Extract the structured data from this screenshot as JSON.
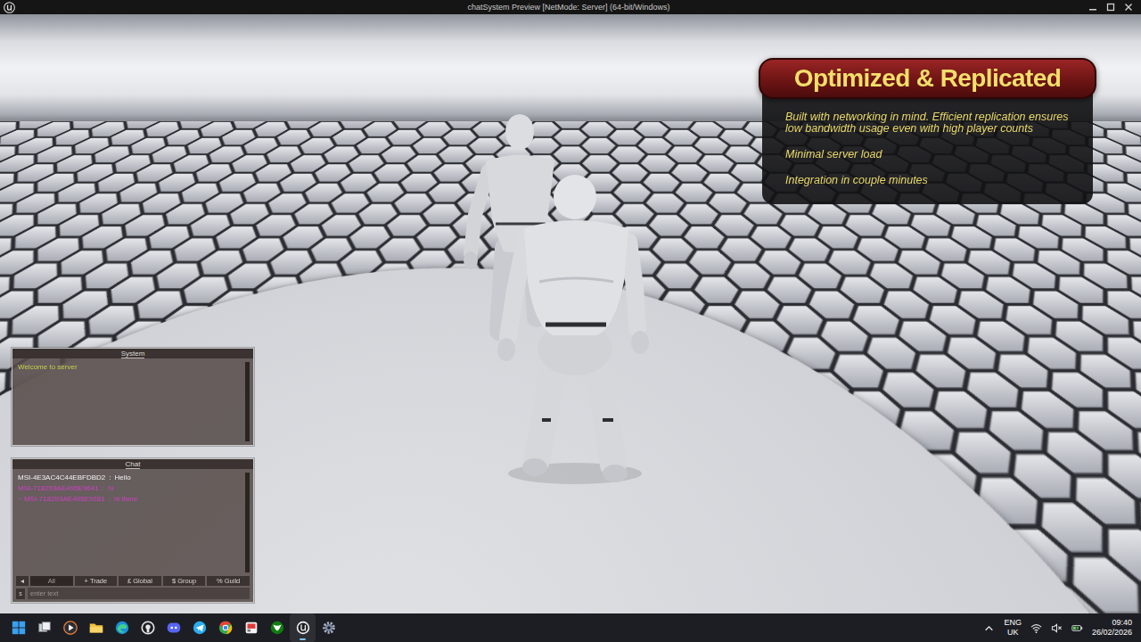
{
  "window": {
    "title": "chatSystem Preview [NetMode: Server]  (64-bit/Windows)"
  },
  "info_panel": {
    "title": "Optimized & Replicated",
    "lines": [
      "Built with networking in mind. Efficient replication ensures low bandwidth usage even with high player counts",
      "Minimal server load",
      "Integration in couple minutes"
    ]
  },
  "system_panel": {
    "title": "System",
    "messages": [
      {
        "text": "Welcome to server",
        "color": "#c3d24a"
      }
    ]
  },
  "chat_panel": {
    "title": "Chat",
    "messages": [
      {
        "sender": "MSI-4E3AC4C44EBFDBD2",
        "separator": ":",
        "text": "Hello",
        "color": "#f2f2f2"
      },
      {
        "sender": "MSI-718293AE495E9641",
        "separator": ":",
        "text": "hi",
        "color": "#d23fc8"
      },
      {
        "sender": "~ MSI-718293AE495E9281",
        "separator": ":",
        "text": "hi there",
        "color": "#d23fc8"
      }
    ],
    "scroll_button": "◂",
    "tabs": [
      {
        "label": "All",
        "selected": true
      },
      {
        "label": "+ Trade",
        "selected": false
      },
      {
        "label": "£ Global",
        "selected": false
      },
      {
        "label": "$ Group",
        "selected": false
      },
      {
        "label": "% Guild",
        "selected": false
      }
    ],
    "input": {
      "prefix": "s",
      "placeholder": "enter text"
    }
  },
  "taskbar": {
    "apps": [
      {
        "active": false
      },
      {
        "active": false
      },
      {
        "active": false
      },
      {
        "active": false
      },
      {
        "active": false
      },
      {
        "active": false
      },
      {
        "active": false
      },
      {
        "active": false
      },
      {
        "active": false
      },
      {
        "active": false
      },
      {
        "active": false
      },
      {
        "active": true
      },
      {
        "active": false
      }
    ],
    "language": "ENG",
    "region": "UK",
    "time": "09:40",
    "date": "26/02/2026"
  }
}
